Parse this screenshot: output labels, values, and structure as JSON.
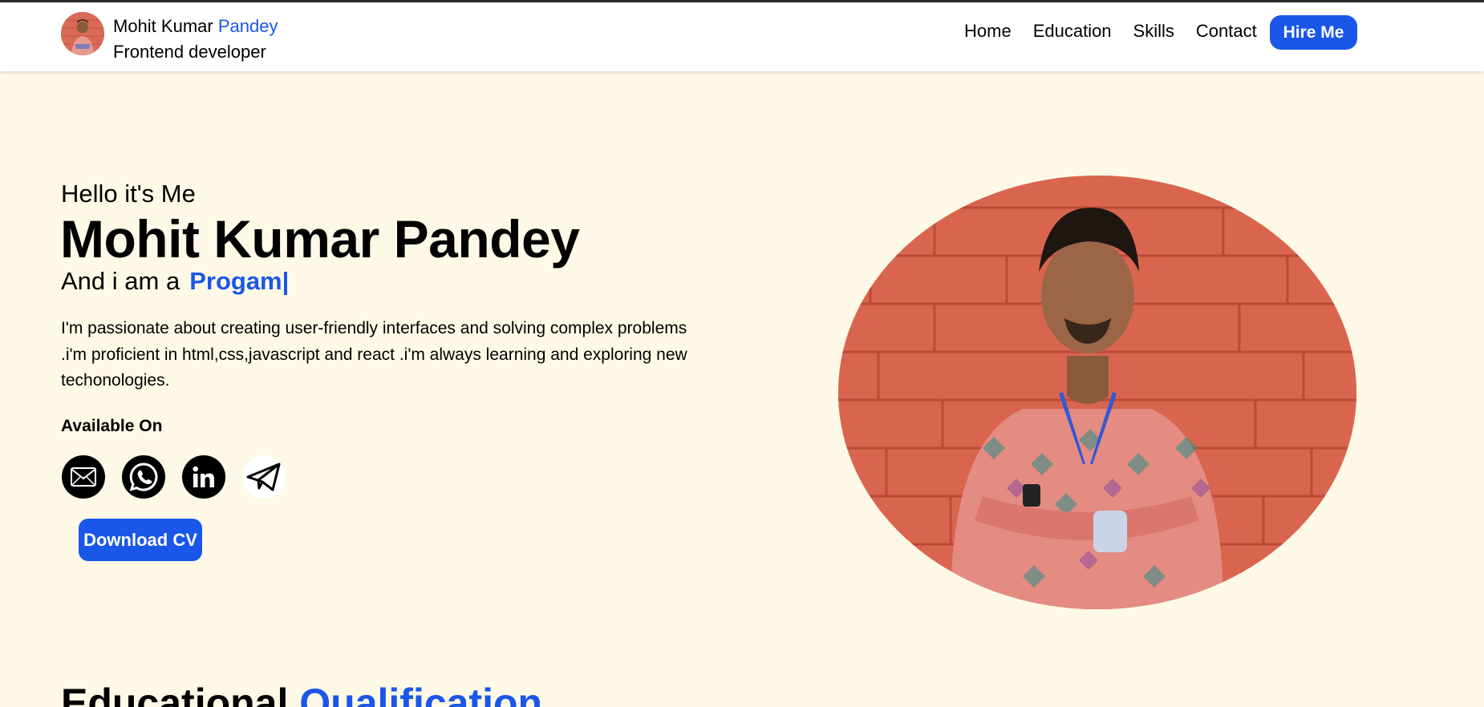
{
  "header": {
    "name_first": "Mohit Kumar ",
    "name_accent": "Pandey",
    "role": "Frontend developer",
    "nav": [
      "Home",
      "Education",
      "Skills",
      "Contact"
    ],
    "hire_label": "Hire Me"
  },
  "hero": {
    "greeting": "Hello it's Me",
    "name": "Mohit Kumar Pandey",
    "iam_prefix": "And i am a",
    "typed_text": "Progam|",
    "bio": "I'm passionate about creating user-friendly interfaces and solving complex problems .i'm proficient in html,css,javascript and react .i'm always learning and exploring new techonologies.",
    "available_label": "Available On",
    "socials": [
      "mail-icon",
      "whatsapp-icon",
      "linkedin-icon",
      "telegram-icon"
    ],
    "download_label": "Download CV"
  },
  "education": {
    "title_first": "Educational ",
    "title_accent": "Qualification"
  },
  "colors": {
    "accent": "#1a56e8",
    "background": "#fdf9e6"
  }
}
